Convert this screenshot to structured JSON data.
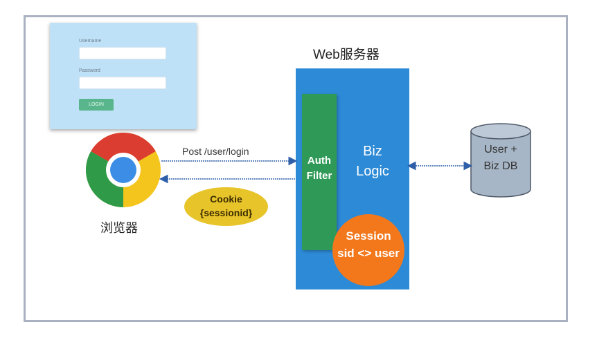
{
  "login_form": {
    "username_label": "Username",
    "password_label": "Password",
    "login_button": "LOGIN"
  },
  "browser": {
    "label": "浏览器"
  },
  "server": {
    "title": "Web服务器",
    "filter_line1": "Auth",
    "filter_line2": "Filter",
    "biz_line1": "Biz",
    "biz_line2": "Logic",
    "session_line1": "Session",
    "session_line2": "sid <> user"
  },
  "database": {
    "line1": "User +",
    "line2": "Biz DB"
  },
  "request": {
    "label": "Post /user/login"
  },
  "response": {
    "line1": "Cookie",
    "line2": "{sessionid}"
  },
  "colors": {
    "server": "#2d8ad6",
    "filter": "#2f9a57",
    "session": "#f3781b",
    "cookie": "#e8c42b",
    "arrow": "#2f5fa8",
    "db": "#a7b6c7"
  }
}
